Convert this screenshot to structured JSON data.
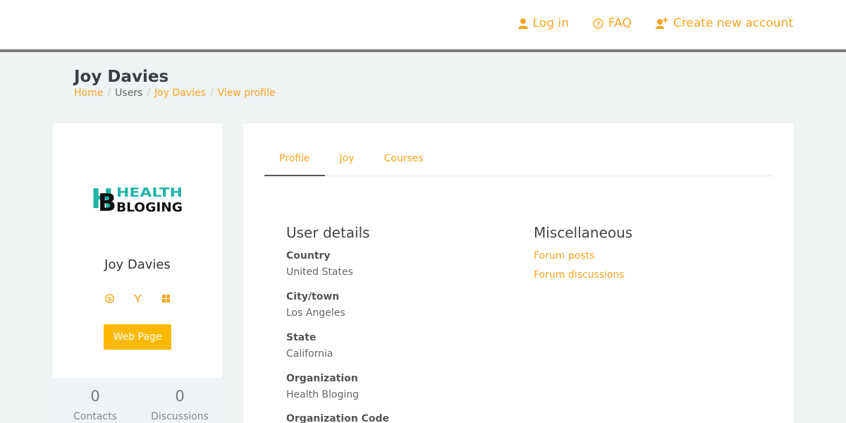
{
  "topnav": {
    "login": "Log in",
    "faq": "FAQ",
    "create_account": "Create new account"
  },
  "page": {
    "title": "Joy Davies",
    "breadcrumb": [
      "Home",
      "Users",
      "Joy Davies",
      "View profile"
    ]
  },
  "sidebar": {
    "logo_text_top": "HEALTH",
    "logo_text_bottom": "BLOGING",
    "logo_letters": "HB",
    "name": "Joy Davies",
    "social_icons": [
      "skype-icon",
      "yahoo-icon",
      "windows-icon"
    ],
    "webpage_button": "Web Page",
    "stats": [
      {
        "value": "0",
        "label": "Contacts"
      },
      {
        "value": "0",
        "label": "Discussions"
      }
    ]
  },
  "tabs": [
    "Profile",
    "Joy",
    "Courses"
  ],
  "user_details": {
    "title": "User details",
    "fields": [
      {
        "label": "Country",
        "value": "United States"
      },
      {
        "label": "City/town",
        "value": "Los Angeles"
      },
      {
        "label": "State",
        "value": "California"
      },
      {
        "label": "Organization",
        "value": "Health Bloging"
      },
      {
        "label": "Organization Code",
        "value": ""
      }
    ]
  },
  "misc": {
    "title": "Miscellaneous",
    "links": [
      "Forum posts",
      "Forum discussions"
    ]
  },
  "colors": {
    "accent": "#f5a623",
    "button": "#fbb800",
    "logo_teal": "#1fb5a8"
  }
}
